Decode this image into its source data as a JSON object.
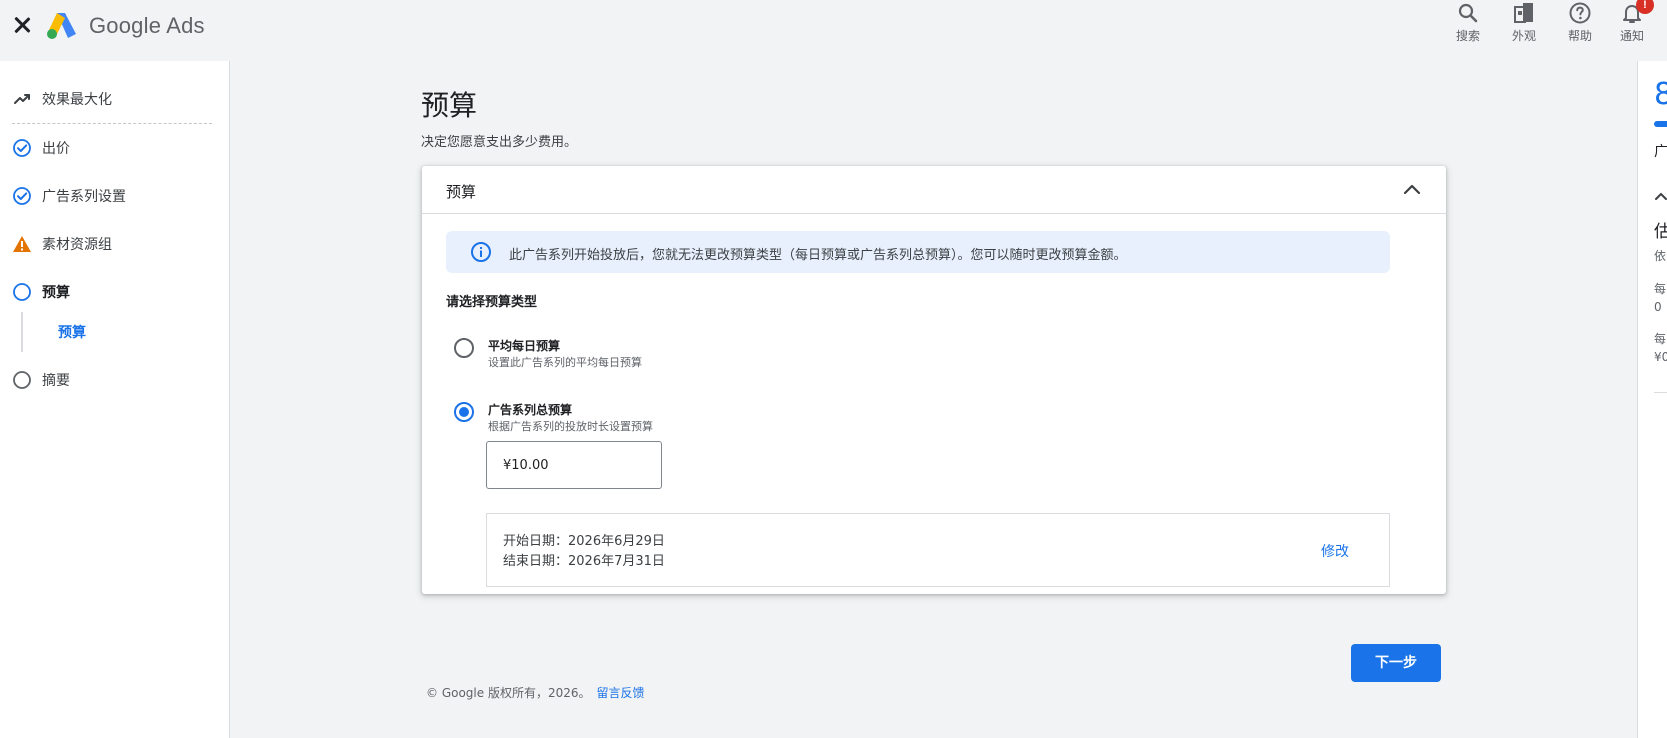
{
  "header": {
    "brand": "Google Ads",
    "actions": [
      {
        "label": "搜索",
        "icon": "search-icon"
      },
      {
        "label": "外观",
        "icon": "appearance-icon"
      },
      {
        "label": "帮助",
        "icon": "help-icon"
      },
      {
        "label": "通知",
        "icon": "bell-icon",
        "badge": "!"
      }
    ]
  },
  "sidebar": {
    "items": [
      {
        "label": "效果最大化",
        "icon": "performance-max-icon"
      },
      {
        "label": "出价",
        "icon": "check-circle-icon"
      },
      {
        "label": "广告系列设置",
        "icon": "check-circle-icon"
      },
      {
        "label": "素材资源组",
        "icon": "warning-icon"
      },
      {
        "label": "预算",
        "icon": "circle-icon"
      },
      {
        "label": "摘要",
        "icon": "circle-icon"
      }
    ],
    "sub_item": "预算"
  },
  "main": {
    "title": "预算",
    "subtitle": "决定您愿意支出多少费用。",
    "card": {
      "title": "预算",
      "info": "此广告系列开始投放后，您就无法更改预算类型（每日预算或广告系列总预算）。您可以随时更改预算金额。",
      "select_label": "请选择预算类型",
      "options": [
        {
          "title": "平均每日预算",
          "desc": "设置此广告系列的平均每日预算",
          "checked": false
        },
        {
          "title": "广告系列总预算",
          "desc": "根据广告系列的投放时长设置预算",
          "checked": true
        }
      ],
      "amount": "¥10.00",
      "start_date": "开始日期：2026年6月29日",
      "end_date": "结束日期：2026年7月31日",
      "edit_label": "修改"
    },
    "next_label": "下一步",
    "footer": {
      "copyright": "© Google 版权所有，2026。",
      "feedback": "留言反馈"
    }
  },
  "right_panel": {
    "number": "8",
    "line1": "广",
    "line2": "估",
    "line3": "依",
    "line4": "每",
    "line5": "0",
    "line6": "每",
    "line7": "¥0"
  },
  "colors": {
    "accent": "#1a73e8",
    "warning": "#e37400",
    "background": "#f1f3f4",
    "badge": "#d93025"
  }
}
